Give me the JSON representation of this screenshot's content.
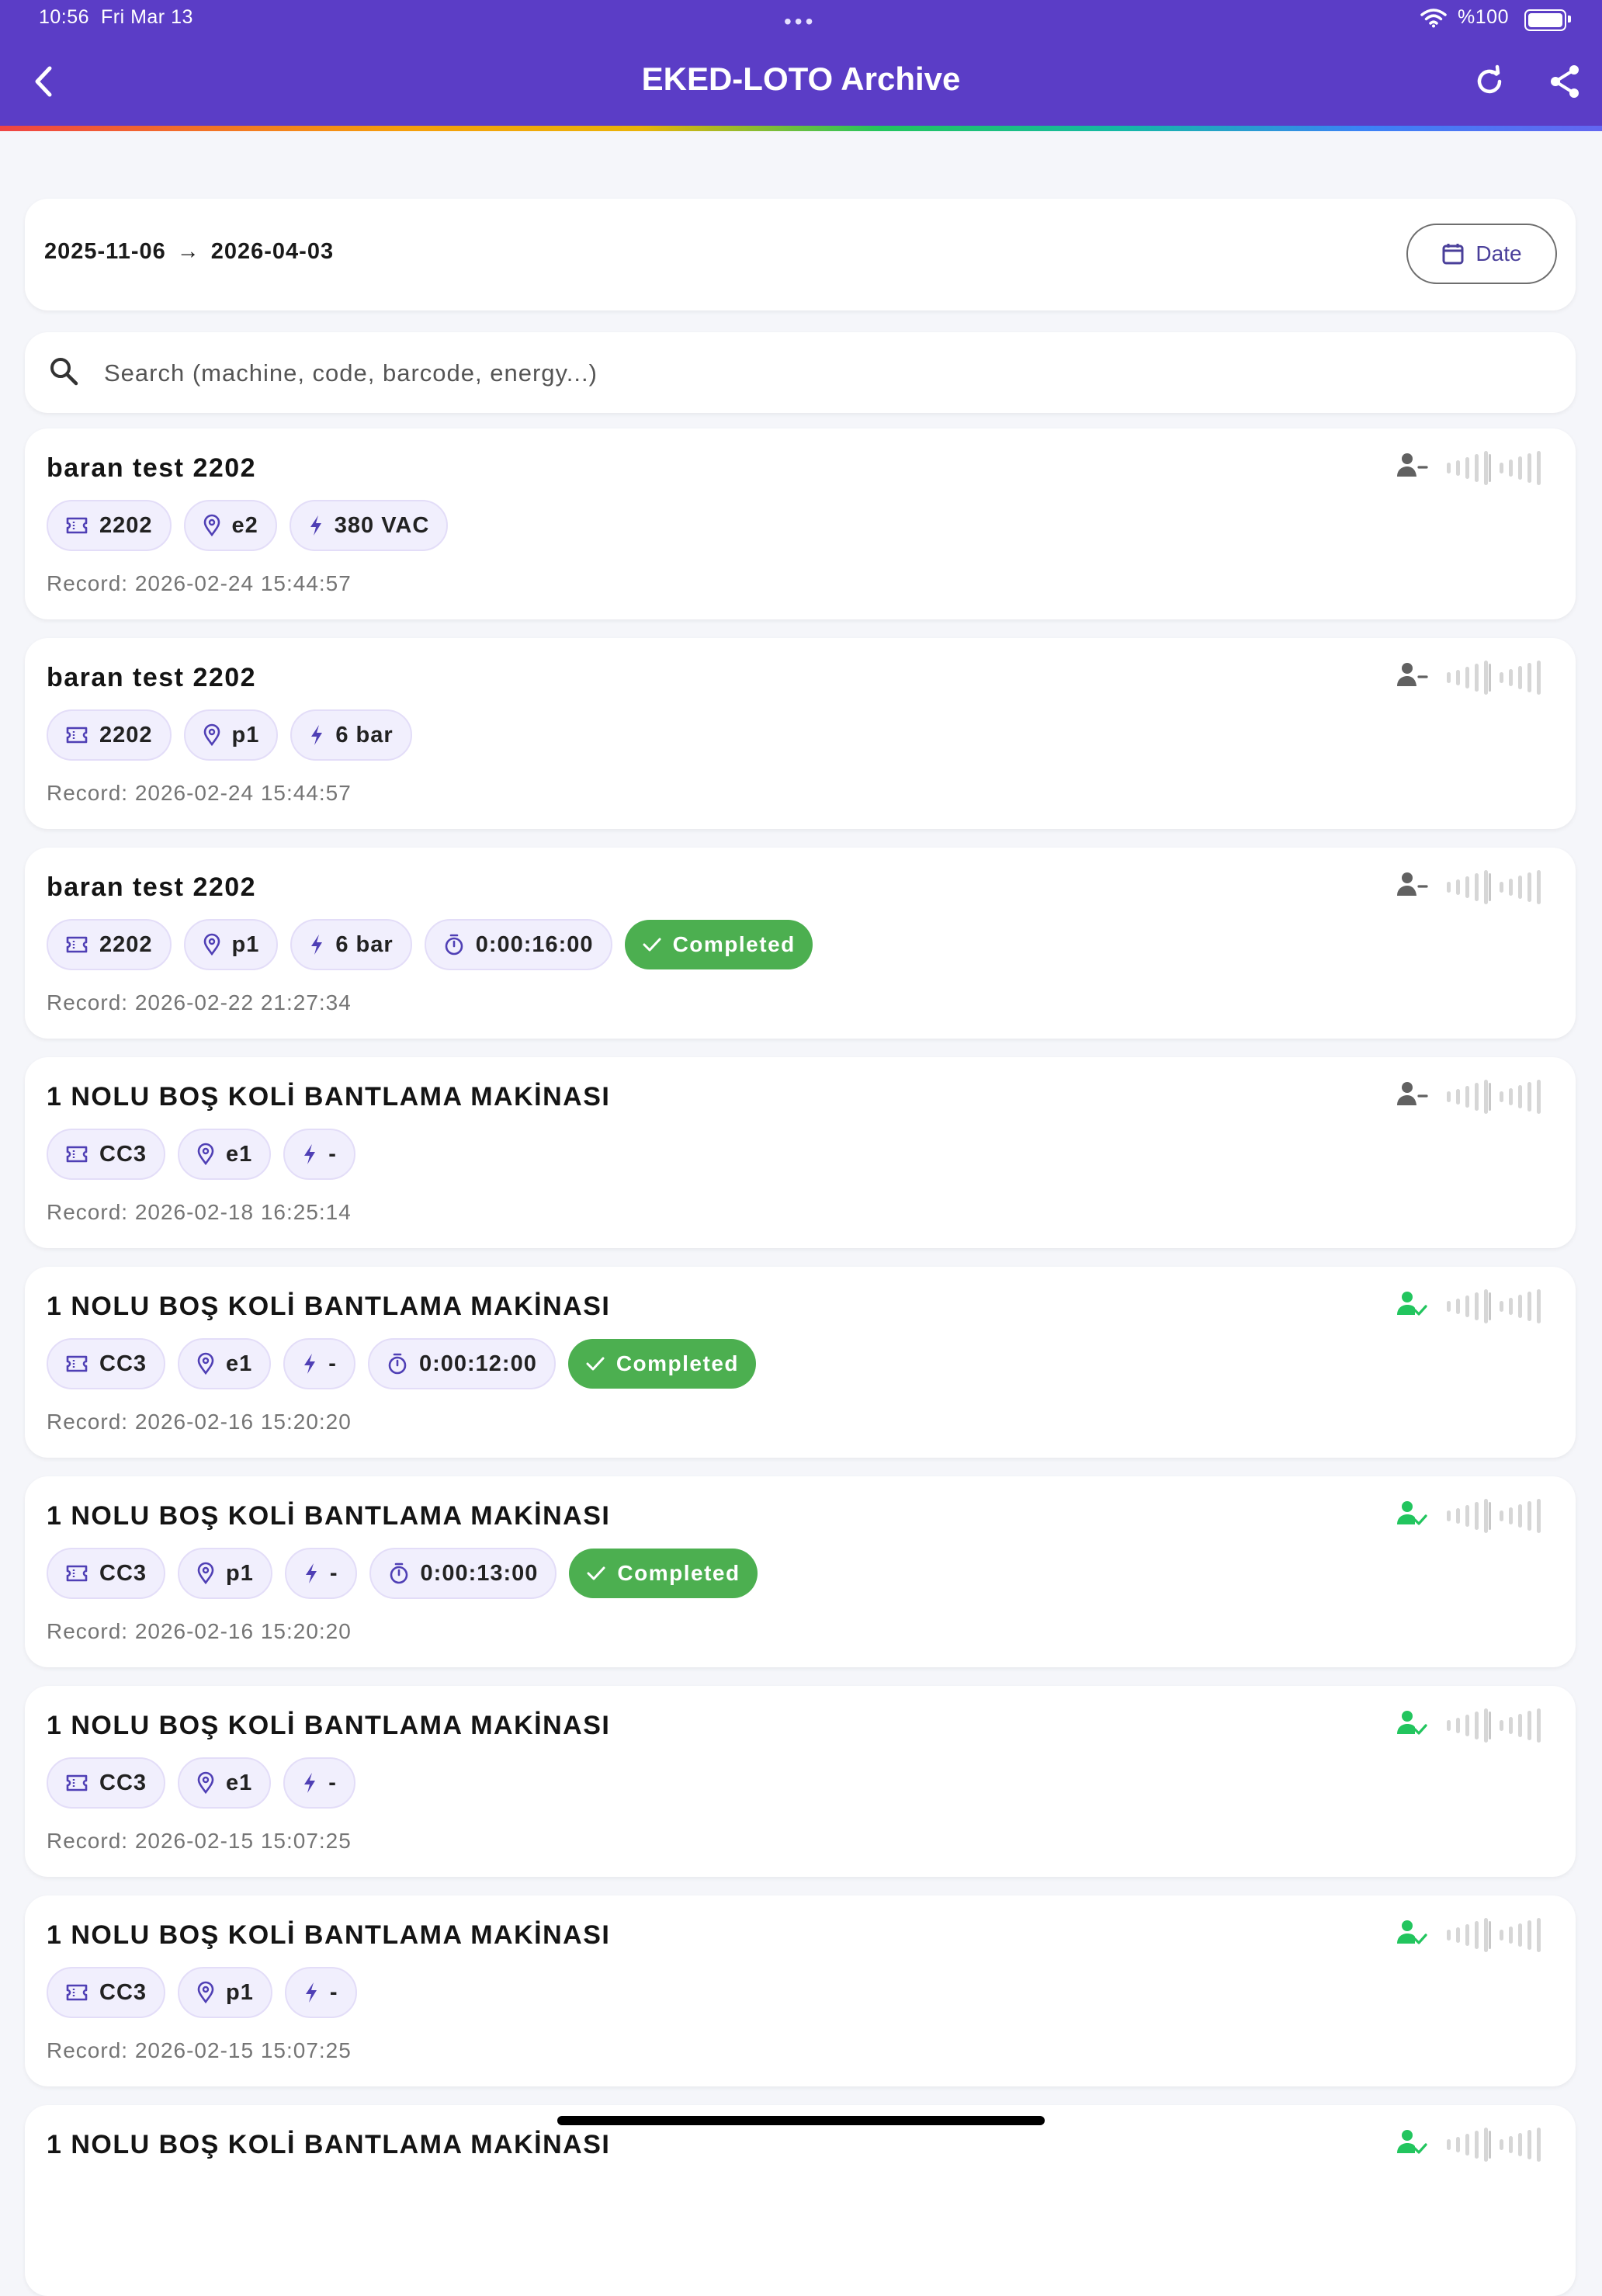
{
  "status_bar": {
    "time": "10:56",
    "date": "Fri Mar 13",
    "battery": "%100"
  },
  "header": {
    "title": "EKED-LOTO Archive"
  },
  "range": {
    "start": "2025-11-06",
    "arrow": "→",
    "end": "2026-04-03",
    "date_button": "Date"
  },
  "search": {
    "placeholder": "Search (machine, code, barcode, energy...)"
  },
  "colors": {
    "header": "#5b3dc6",
    "completed": "#4caf50",
    "user_active": "#22c55e",
    "user_inactive": "#616161"
  },
  "records": [
    {
      "title": "baran test 2202",
      "code": "2202",
      "location": "e2",
      "energy": "380 VAC",
      "duration": "",
      "status": "",
      "record": "Record: 2026-02-24 15:44:57",
      "user_icon": "person-remove-icon"
    },
    {
      "title": "baran test 2202",
      "code": "2202",
      "location": "p1",
      "energy": "6 bar",
      "duration": "",
      "status": "",
      "record": "Record: 2026-02-24 15:44:57",
      "user_icon": "person-remove-icon"
    },
    {
      "title": "baran test 2202",
      "code": "2202",
      "location": "p1",
      "energy": "6 bar",
      "duration": "0:00:16:00",
      "status": "Completed",
      "record": "Record: 2026-02-22 21:27:34",
      "user_icon": "person-remove-icon"
    },
    {
      "title": "1 NOLU BOŞ KOLİ BANTLAMA MAKİNASI",
      "code": "CC3",
      "location": "e1",
      "energy": "-",
      "duration": "",
      "status": "",
      "record": "Record: 2026-02-18 16:25:14",
      "user_icon": "person-remove-icon"
    },
    {
      "title": "1 NOLU BOŞ KOLİ BANTLAMA MAKİNASI",
      "code": "CC3",
      "location": "e1",
      "energy": "-",
      "duration": "0:00:12:00",
      "status": "Completed",
      "record": "Record: 2026-02-16 15:20:20",
      "user_icon": "person-check-icon"
    },
    {
      "title": "1 NOLU BOŞ KOLİ BANTLAMA MAKİNASI",
      "code": "CC3",
      "location": "p1",
      "energy": "-",
      "duration": "0:00:13:00",
      "status": "Completed",
      "record": "Record: 2026-02-16 15:20:20",
      "user_icon": "person-check-icon"
    },
    {
      "title": "1 NOLU BOŞ KOLİ BANTLAMA MAKİNASI",
      "code": "CC3",
      "location": "e1",
      "energy": "-",
      "duration": "",
      "status": "",
      "record": "Record: 2026-02-15 15:07:25",
      "user_icon": "person-check-icon"
    },
    {
      "title": "1 NOLU BOŞ KOLİ BANTLAMA MAKİNASI",
      "code": "CC3",
      "location": "p1",
      "energy": "-",
      "duration": "",
      "status": "",
      "record": "Record: 2026-02-15 15:07:25",
      "user_icon": "person-check-icon"
    },
    {
      "title": "1 NOLU BOŞ KOLİ BANTLAMA MAKİNASI",
      "code": "",
      "location": "",
      "energy": "",
      "duration": "",
      "status": "",
      "record": "",
      "user_icon": "person-check-icon"
    }
  ]
}
